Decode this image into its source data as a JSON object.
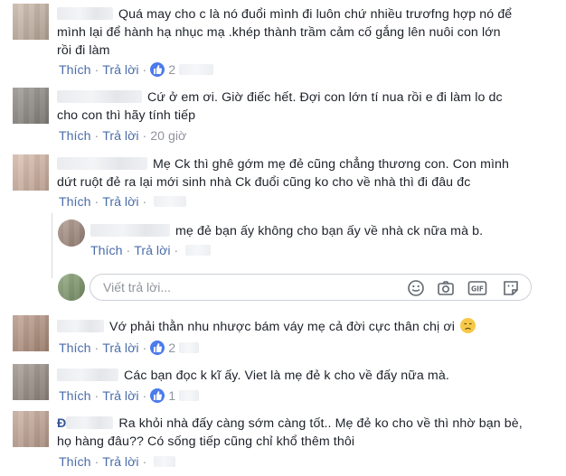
{
  "labels": {
    "like": "Thích",
    "reply": "Trả lời",
    "dot": "·"
  },
  "comments": [
    {
      "text_line1": "Quá may cho c là nó đuổi mình đi luôn chứ nhiều trươfng hợp nó để",
      "text_line2": "mình lại để hành hạ nhục mạ .khép thành trầm cảm cố gắng lên nuôi con lớn",
      "text_line3": "rồi đi làm",
      "like_count": "2"
    },
    {
      "text_line1": "Cứ ở em ơi. Giờ điếc hết. Đợi con lớn tí nua rồi e đi làm lo dc",
      "text_line2": "cho con thì hãy tính tiếp",
      "time": "20 giờ"
    },
    {
      "text_line1": "Mẹ Ck thì ghê gớm mẹ đẻ cũng chẳng thương con. Con mình",
      "text_line2": "dứt ruột đẻ ra lại mới sinh nhà Ck đuổi cũng ko cho về nhà thì đi đâu đc"
    },
    {
      "text_line1": "mẹ đẻ bạn ấy không cho bạn ấy về nhà ck nữa mà b."
    },
    {
      "text_line1": "Vớ phải thằn nhu nhược bám váy mẹ cả đời cực thân chị ơi",
      "like_count": "2"
    },
    {
      "text_line1": "Các bạn đọc k kĩ ấy. Viet là mẹ đẻ k cho về đấy nữa mà.",
      "like_count": "1"
    },
    {
      "name_initial": "Đ",
      "text_line1": "Ra khỏi nhà đấy càng sớm càng tốt.. Mẹ đẻ ko cho về thì nhờ bạn bè,",
      "text_line2": "họ hàng đâu?? Có sống tiếp cũng chỉ khổ thêm thôi"
    }
  ],
  "reply_box": {
    "placeholder": "Viết trả lời..."
  },
  "icons": [
    "like-icon",
    "smile-icon",
    "camera-icon",
    "gif-icon",
    "sticker-icon",
    "sad-emoji-icon"
  ],
  "colors": {
    "link": "#4b6daa",
    "meta": "#90949c",
    "text": "#1d2129",
    "like": "#4b7bec"
  }
}
